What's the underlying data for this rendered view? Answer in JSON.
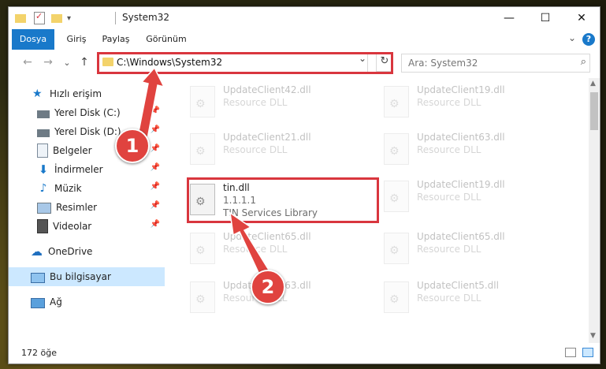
{
  "window": {
    "title": "System32",
    "min_glyph": "—",
    "max_glyph": "☐",
    "close_glyph": "✕"
  },
  "ribbon": {
    "tabs": [
      "Dosya",
      "Giriş",
      "Paylaş",
      "Görünüm"
    ],
    "collapse_glyph": "⌄",
    "help_glyph": "?"
  },
  "nav": {
    "back_glyph": "←",
    "forward_glyph": "→",
    "recent_glyph": "⌄",
    "up_glyph": "↑"
  },
  "address": {
    "path": "C:\\Windows\\System32",
    "dropdown_glyph": "⌄",
    "refresh_glyph": "↻"
  },
  "search": {
    "placeholder": "Ara: System32",
    "icon_glyph": "⌕"
  },
  "sidebar": {
    "items": [
      {
        "label": "Hızlı erişim",
        "icon": "star-icon"
      },
      {
        "label": "Yerel Disk (C:)",
        "icon": "drive-icon",
        "pinned": true
      },
      {
        "label": "Yerel Disk (D:)",
        "icon": "drive-icon",
        "pinned": true
      },
      {
        "label": "Belgeler",
        "icon": "documents-icon",
        "pinned": true
      },
      {
        "label": "İndirmeler",
        "icon": "download-icon",
        "pinned": true
      },
      {
        "label": "Müzik",
        "icon": "music-icon",
        "pinned": true
      },
      {
        "label": "Resimler",
        "icon": "pictures-icon",
        "pinned": true
      },
      {
        "label": "Videolar",
        "icon": "videos-icon",
        "pinned": true
      },
      {
        "label": "OneDrive",
        "icon": "cloud-icon"
      },
      {
        "label": "Bu bilgisayar",
        "icon": "computer-icon",
        "selected": true
      },
      {
        "label": "Ağ",
        "icon": "network-icon"
      }
    ],
    "pin_glyph": "📌"
  },
  "files": [
    {
      "name": "UpdateClient42.dll",
      "lines": [
        "Resource DLL"
      ],
      "faded": true
    },
    {
      "name": "UpdateClient19.dll",
      "lines": [
        "Resource DLL"
      ],
      "faded": true
    },
    {
      "name": "UpdateClient21.dll",
      "lines": [
        "Resource DLL"
      ],
      "faded": true
    },
    {
      "name": "UpdateClient63.dll",
      "lines": [
        "Resource DLL"
      ],
      "faded": true
    },
    {
      "name": "tin.dll",
      "lines": [
        "1.1.1.1",
        "TIN Services Library"
      ],
      "faded": false
    },
    {
      "name": "UpdateClient19.dll",
      "lines": [
        "Resource DLL"
      ],
      "faded": true
    },
    {
      "name": "UpdateClient65.dll",
      "lines": [
        "Resource DLL"
      ],
      "faded": true
    },
    {
      "name": "UpdateClient65.dll",
      "lines": [
        "Resource DLL"
      ],
      "faded": true
    },
    {
      "name": "UpdateClient63.dll",
      "lines": [
        "Resource DLL"
      ],
      "faded": true
    },
    {
      "name": "UpdateClient5.dll",
      "lines": [
        "Resource DLL"
      ],
      "faded": true
    }
  ],
  "status": {
    "count": "172 öğe"
  },
  "callouts": [
    "1",
    "2"
  ],
  "colors": {
    "accent": "#1979ca",
    "highlight_box": "#d9363e",
    "callout": "#e0433f",
    "selected_nav": "#cce8ff"
  }
}
